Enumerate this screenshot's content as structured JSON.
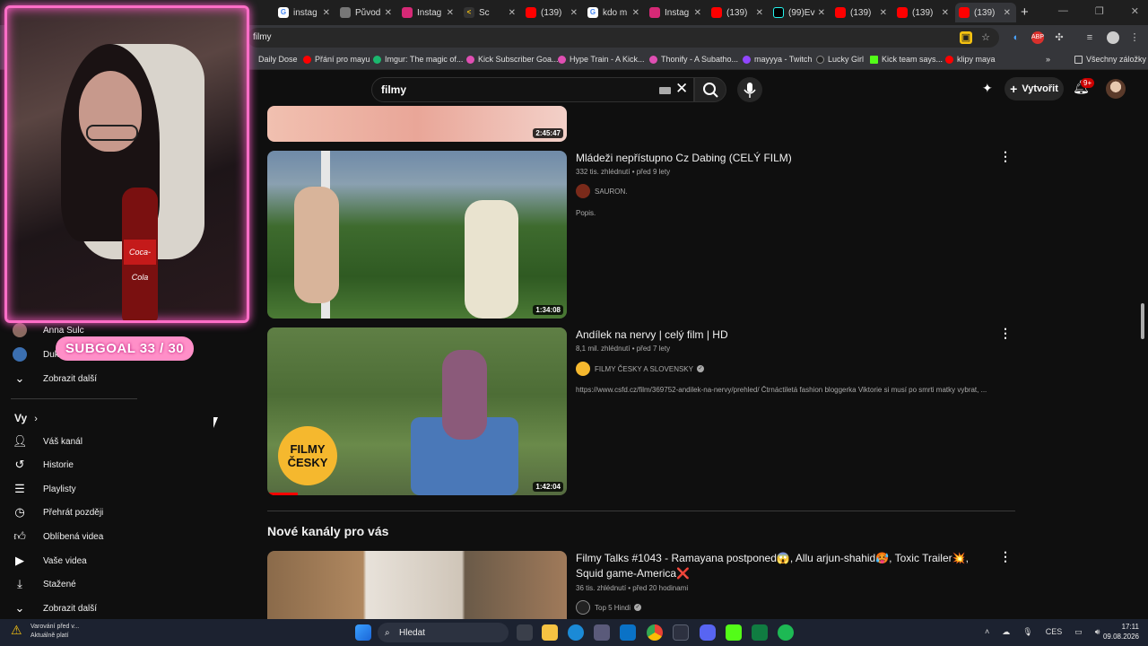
{
  "browser": {
    "tabs": [
      {
        "title": "instag",
        "icon": "google-icon"
      },
      {
        "title": "Původ",
        "icon": "google-icon"
      },
      {
        "title": "Instag",
        "icon": "instagram-icon"
      },
      {
        "title": "Sc",
        "icon": "sc-icon"
      },
      {
        "title": "(139)",
        "icon": "youtube-icon"
      },
      {
        "title": "kdo m",
        "icon": "google-icon"
      },
      {
        "title": "Instag",
        "icon": "instagram-icon"
      },
      {
        "title": "(139)",
        "icon": "youtube-icon"
      },
      {
        "title": "(99)Ev",
        "icon": "tiktok-icon"
      },
      {
        "title": "(139)",
        "icon": "youtube-icon"
      },
      {
        "title": "(139)",
        "icon": "youtube-icon"
      },
      {
        "title": "(139)",
        "icon": "youtube-icon"
      }
    ],
    "url": "filmy",
    "bookmarks": [
      {
        "label": "Daily Dose",
        "color": "#888888"
      },
      {
        "label": "Přání pro mayu",
        "color": "#ff0000"
      },
      {
        "label": "Imgur: The magic of...",
        "color": "#1bb76e"
      },
      {
        "label": "Kick Subscriber Goa...",
        "color": "#e04fb3"
      },
      {
        "label": "Hype Train - A Kick...",
        "color": "#e04fb3"
      },
      {
        "label": "Thonify - A Subatho...",
        "color": "#e04fb3"
      },
      {
        "label": "mayyya - Twitch",
        "color": "#9146ff"
      },
      {
        "label": "Lucky Girl",
        "color": "#222222"
      },
      {
        "label": "Kick team says...",
        "color": "#53fc18"
      },
      {
        "label": "klipy maya",
        "color": "#ff0000"
      }
    ],
    "all_bookmarks": "Všechny záložky"
  },
  "youtube": {
    "search_query": "filmy",
    "create_label": "Vytvořit",
    "notif_badge": "9+"
  },
  "sidebar": {
    "subs": [
      {
        "label": "Anna Sulc"
      },
      {
        "label": "Duk"
      }
    ],
    "show_more": "Zobrazit další",
    "you_heading": "Vy",
    "you_items": [
      {
        "label": "Váš kanál",
        "icon": "channel-icon"
      },
      {
        "label": "Historie",
        "icon": "history-icon"
      },
      {
        "label": "Playlisty",
        "icon": "playlist-icon"
      },
      {
        "label": "Přehrát později",
        "icon": "clock-icon"
      },
      {
        "label": "Oblíbená videa",
        "icon": "like-icon"
      },
      {
        "label": "Vaše videa",
        "icon": "video-icon"
      },
      {
        "label": "Stažené",
        "icon": "download-icon"
      },
      {
        "label": "Zobrazit další",
        "icon": "chevron-down-icon"
      }
    ]
  },
  "overlay": {
    "subgoal": "SUBGOAL  33 / 30",
    "bottle_label": "Coca-Cola"
  },
  "videos": [
    {
      "duration": "2:45:47"
    },
    {
      "title": "Mládeži nepřístupno Cz Dabing (CELÝ FILM)",
      "meta": "332 tis. zhlédnutí • před 9 lety",
      "channel": "SAURON.",
      "desc": "Popis.",
      "duration": "1:34:08"
    },
    {
      "title": "Andílek na nervy | celý film | HD",
      "meta": "8,1 mil. zhlédnutí • před 7 lety",
      "channel": "FILMY ČESKY A SLOVENSKY",
      "desc": "https://www.csfd.cz/film/369752-andilek-na-nervy/prehled/ Čtrnáctiletá fashion bloggerka Viktorie si musí po smrti matky vybrat, ...",
      "duration": "1:42:04",
      "thumb_badge": "FILMY ČESKY"
    }
  ],
  "new_channels": {
    "heading": "Nové kanály pro vás",
    "video": {
      "title": "Filmy Talks #1043 - Ramayana postponed😱, Allu arjun-shahid🥵, Toxic Trailer💥, Squid game-America❌",
      "meta": "36 tis. zhlédnutí • před 20 hodinami",
      "channel": "Top 5 Hindi"
    }
  },
  "taskbar": {
    "warning_title": "Varování před v...",
    "warning_sub": "Aktuálně platí",
    "search": "Hledat",
    "lang": "CES",
    "time": "17:11",
    "date": "09.08.2026"
  }
}
